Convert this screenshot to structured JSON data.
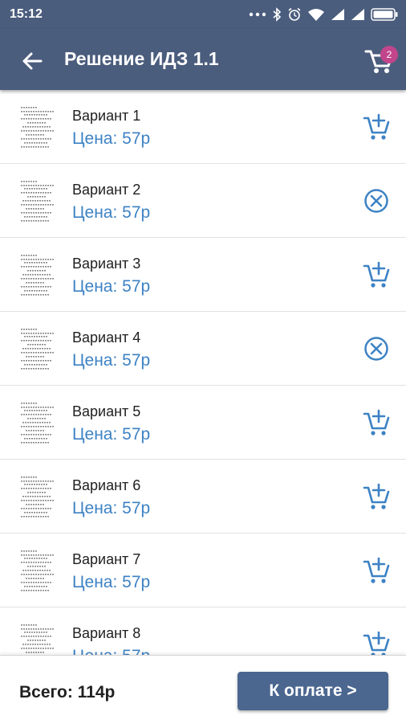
{
  "status_bar": {
    "time": "15:12"
  },
  "header": {
    "title": "Решение ИДЗ 1.1",
    "cart_count": "2"
  },
  "items": [
    {
      "name": "Вариант 1",
      "price": "Цена: 57р",
      "action": "add-to-cart"
    },
    {
      "name": "Вариант 2",
      "price": "Цена: 57р",
      "action": "remove"
    },
    {
      "name": "Вариант 3",
      "price": "Цена: 57р",
      "action": "add-to-cart"
    },
    {
      "name": "Вариант 4",
      "price": "Цена: 57р",
      "action": "remove"
    },
    {
      "name": "Вариант 5",
      "price": "Цена: 57р",
      "action": "add-to-cart"
    },
    {
      "name": "Вариант 6",
      "price": "Цена: 57р",
      "action": "add-to-cart"
    },
    {
      "name": "Вариант 7",
      "price": "Цена: 57р",
      "action": "add-to-cart"
    },
    {
      "name": "Вариант 8",
      "price": "Цена: 57р",
      "action": "add-to-cart"
    }
  ],
  "footer": {
    "total": "Всего: 114р",
    "pay_label": "К оплате >"
  },
  "colors": {
    "app_bar": "#4b5d7d",
    "accent_blue": "#3d82c4",
    "badge": "#c2458c",
    "pay_button": "#4b6790"
  }
}
